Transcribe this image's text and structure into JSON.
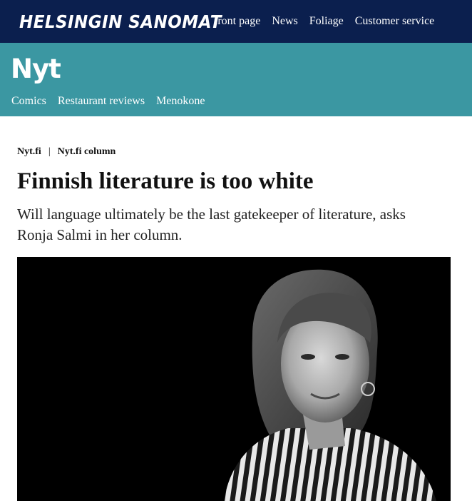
{
  "site": {
    "logo": "HELSINGIN SANOMAT",
    "nav": [
      "front page",
      "News",
      "Foliage",
      "Customer service"
    ]
  },
  "section": {
    "logo": "Nyt",
    "nav": [
      "Comics",
      "Restaurant reviews",
      "Menokone"
    ]
  },
  "article": {
    "breadcrumb": [
      "Nyt.fi",
      "Nyt.fi column"
    ],
    "breadcrumb_separator": "|",
    "title": "Finnish literature is too white",
    "lead": "Will language ultimately be the last gatekeeper of literature, asks Ronja Salmi in her column.",
    "image": {
      "kind": "black-and-white portrait photo",
      "background_color": "#000000"
    }
  },
  "colors": {
    "topbar": "#0b1f4e",
    "section_bar": "#3b97a2",
    "text": "#111111"
  }
}
